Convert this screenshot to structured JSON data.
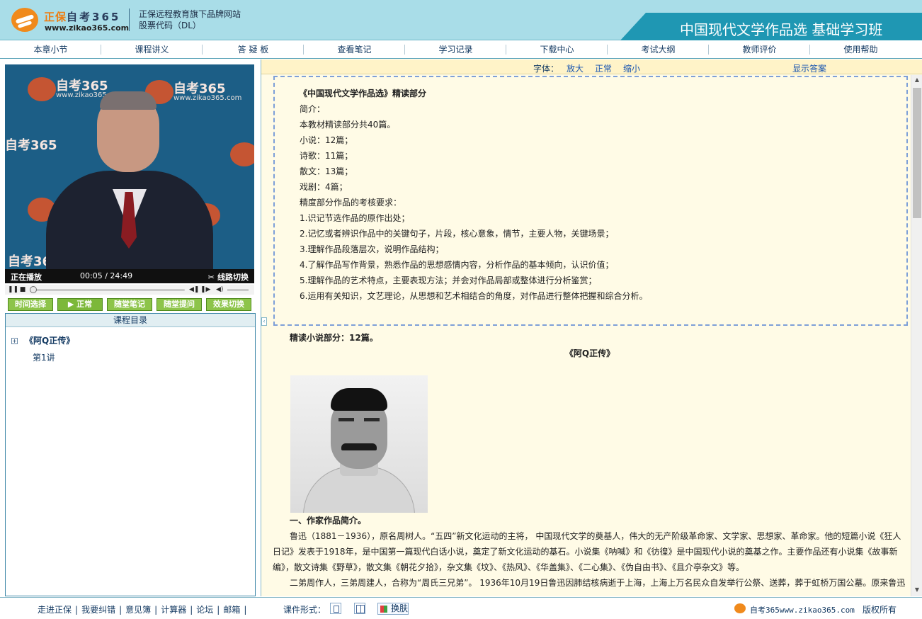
{
  "header": {
    "brand": "正保",
    "brand_sub": "自考365",
    "url": "www.zikao365.com",
    "slogan_line1": "正保远程教育旗下品牌网站",
    "slogan_line2": "股票代码（DL）",
    "banner_title": "中国现代文学作品选 基础学习班",
    "colors": {
      "header_bg": "#a9dde8",
      "banner_bg": "#1f97b3",
      "brand_orange": "#ee7d12"
    }
  },
  "nav": {
    "items": [
      "本章小节",
      "课程讲义",
      "答 疑 板",
      "查看笔记",
      "学习记录",
      "下载中心",
      "考试大纲",
      "教师评价",
      "使用帮助"
    ]
  },
  "player": {
    "watermark_text": "自考365",
    "watermark_url": "www.zikao365.com",
    "status": "正在播放",
    "time": "00:05 / 24:49",
    "line_switch": "线路切换",
    "controls": {
      "pause_icon": "pause-icon",
      "stop_icon": "stop-icon",
      "prev_icon": "prev-icon",
      "next_icon": "next-icon",
      "volume_icon": "volume-icon"
    },
    "progress_fraction": 0.003
  },
  "toolbar": {
    "time_select": "时间选择",
    "normal": "正常",
    "note": "随堂笔记",
    "question": "随堂提问",
    "effect_switch": "效果切换"
  },
  "catalog": {
    "title": "课程目录",
    "node": "《阿Q正传》",
    "node_expand": "+",
    "leaf": "第1讲"
  },
  "font_bar": {
    "label": "字体：",
    "enlarge": "放大",
    "normal": "正常",
    "shrink": "缩小",
    "show_answer": "显示答案"
  },
  "content": {
    "intro_lines": [
      "《中国现代文学作品选》精读部分",
      "简介：",
      "本教材精读部分共40篇。",
      "小说：12篇；",
      "诗歌：11篇；",
      "散文：13篇；",
      "戏剧：4篇；",
      "精度部分作品的考核要求：",
      "1.识记节选作品的原作出处；",
      "2.记忆或者辨识作品中的关键句子，片段，核心意象，情节，主要人物，关键场景；",
      "3.理解作品段落层次，说明作品结构；",
      "4.了解作品写作背景，熟悉作品的思想感情内容，分析作品的基本倾向，认识价值；",
      "5.理解作品的艺术特点，主要表现方法；并会对作品局部或整体进行分析鉴赏；",
      "6.运用有关知识，文艺理论，从思想和艺术相结合的角度，对作品进行整体把握和综合分析。"
    ],
    "section_title": "精读小说部分：12篇。",
    "work_title": "《阿Q正传》",
    "bio_heading": "一、作家作品简介。",
    "para1": "鲁迅（1881－1936），原名周树人。“五四”新文化运动的主将， 中国现代文学的奠基人，伟大的无产阶级革命家、文学家、思想家、革命家。他的短篇小说《狂人日记》发表于1918年，是中国第一篇现代白话小说，奠定了新文化运动的基石。小说集《呐喊》和《彷徨》是中国现代小说的奠基之作。主要作品还有小说集《故事新编》，散文诗集《野草》，散文集《朝花夕拾》，杂文集《坟》、《热风》、《华盖集》、《二心集》、《伪自由书》、《且介亭杂文》等。",
    "para2": "二弟周作人，三弟周建人，合称为“周氏三兄弟”。 1936年10月19日鲁迅因肺结核病逝于上海，上海上万名民众自发举行公祭、送葬，葬于虹桥万国公墓。原来鲁迅"
  },
  "footer": {
    "links": [
      "走进正保",
      "我要纠错",
      "意见簿",
      "计算器",
      "论坛",
      "邮箱"
    ],
    "form_label": "课件形式：",
    "skin": "换肤",
    "site": "自考365www.zikao365.com",
    "copyright": "版权所有"
  }
}
